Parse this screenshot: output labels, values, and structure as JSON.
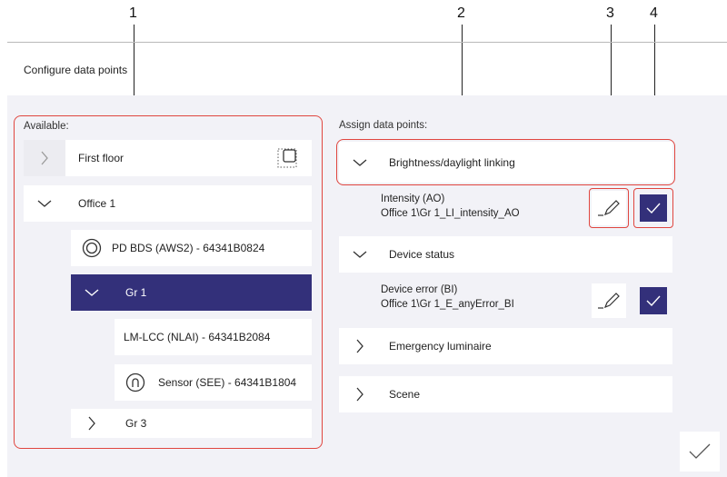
{
  "callouts": [
    "1",
    "2",
    "3",
    "4"
  ],
  "page_title": "Configure data points",
  "available": {
    "label": "Available:",
    "items": [
      {
        "label": "First floor"
      },
      {
        "label": "Office 1"
      },
      {
        "label": "PD BDS (AWS2) - 64341B0824"
      },
      {
        "label": "Gr 1"
      },
      {
        "label": "LM-LCC (NLAI) - 64341B2084"
      },
      {
        "label": "Sensor (SEE) - 64341B1804"
      },
      {
        "label": "Gr 3"
      }
    ]
  },
  "assign": {
    "label": "Assign data points:",
    "groups": [
      {
        "label": "Brightness/daylight linking",
        "expanded": true
      },
      {
        "label": "Device status",
        "expanded": true
      },
      {
        "label": "Emergency luminaire",
        "expanded": false
      },
      {
        "label": "Scene",
        "expanded": false
      }
    ],
    "datapoints": [
      {
        "name": "Intensity (AO)",
        "path": "Office 1\\Gr 1_LI_intensity_AO",
        "checked": true
      },
      {
        "name": "Device error (BI)",
        "path": "Office 1\\Gr 1_E_anyError_BI",
        "checked": true
      }
    ]
  },
  "colors": {
    "accent": "#33307a",
    "highlight": "#e0463f",
    "background": "#f2f2f7"
  },
  "icons": [
    "chevron-right-icon",
    "chevron-down-icon",
    "select-box-icon",
    "ring-device-icon",
    "sensor-icon",
    "pencil-icon",
    "checkmark-icon"
  ]
}
